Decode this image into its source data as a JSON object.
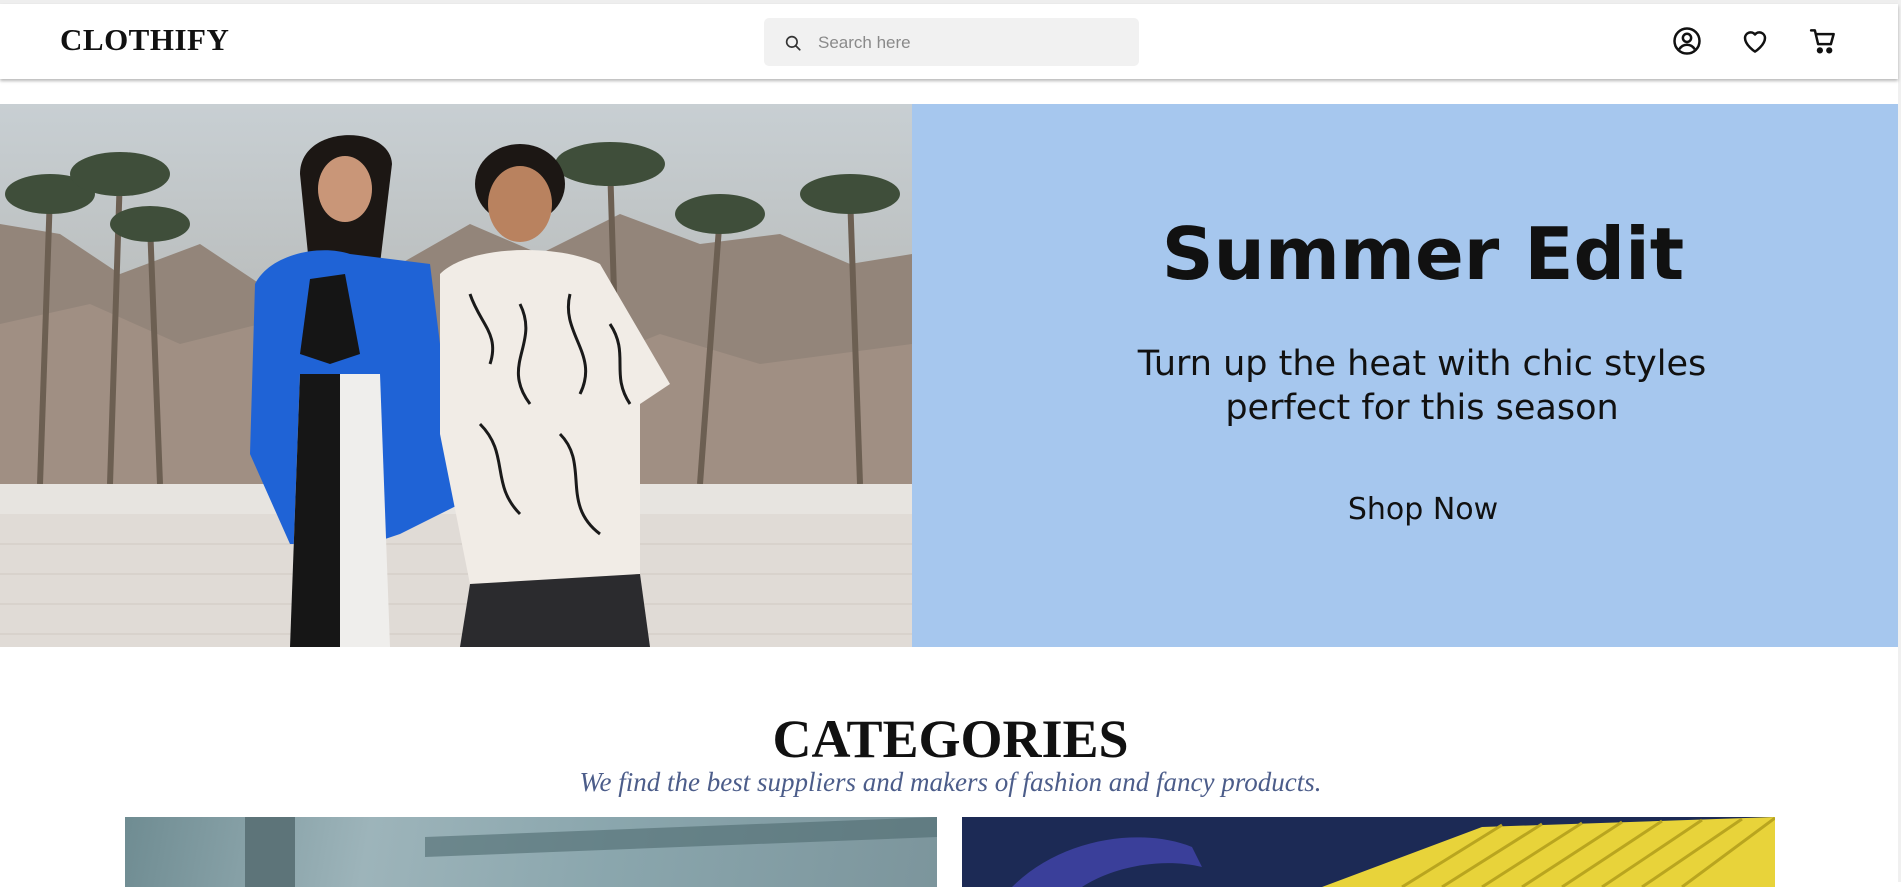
{
  "header": {
    "logo": "CLOTHIFY",
    "search_placeholder": "Search here",
    "icons": [
      "search-icon",
      "account-icon",
      "heart-icon",
      "cart-icon"
    ]
  },
  "hero": {
    "title": "Summer Edit",
    "subtitle_line1": "Turn up the heat with chic styles",
    "subtitle_line2": "perfect for this season",
    "cta": "Shop Now",
    "panel_color": "#a6c7ee"
  },
  "categories": {
    "title": "CATEGORIES",
    "subtitle": "We find the best suppliers and makers of fashion and fancy products.",
    "subtitle_color": "#4c5d8a"
  }
}
